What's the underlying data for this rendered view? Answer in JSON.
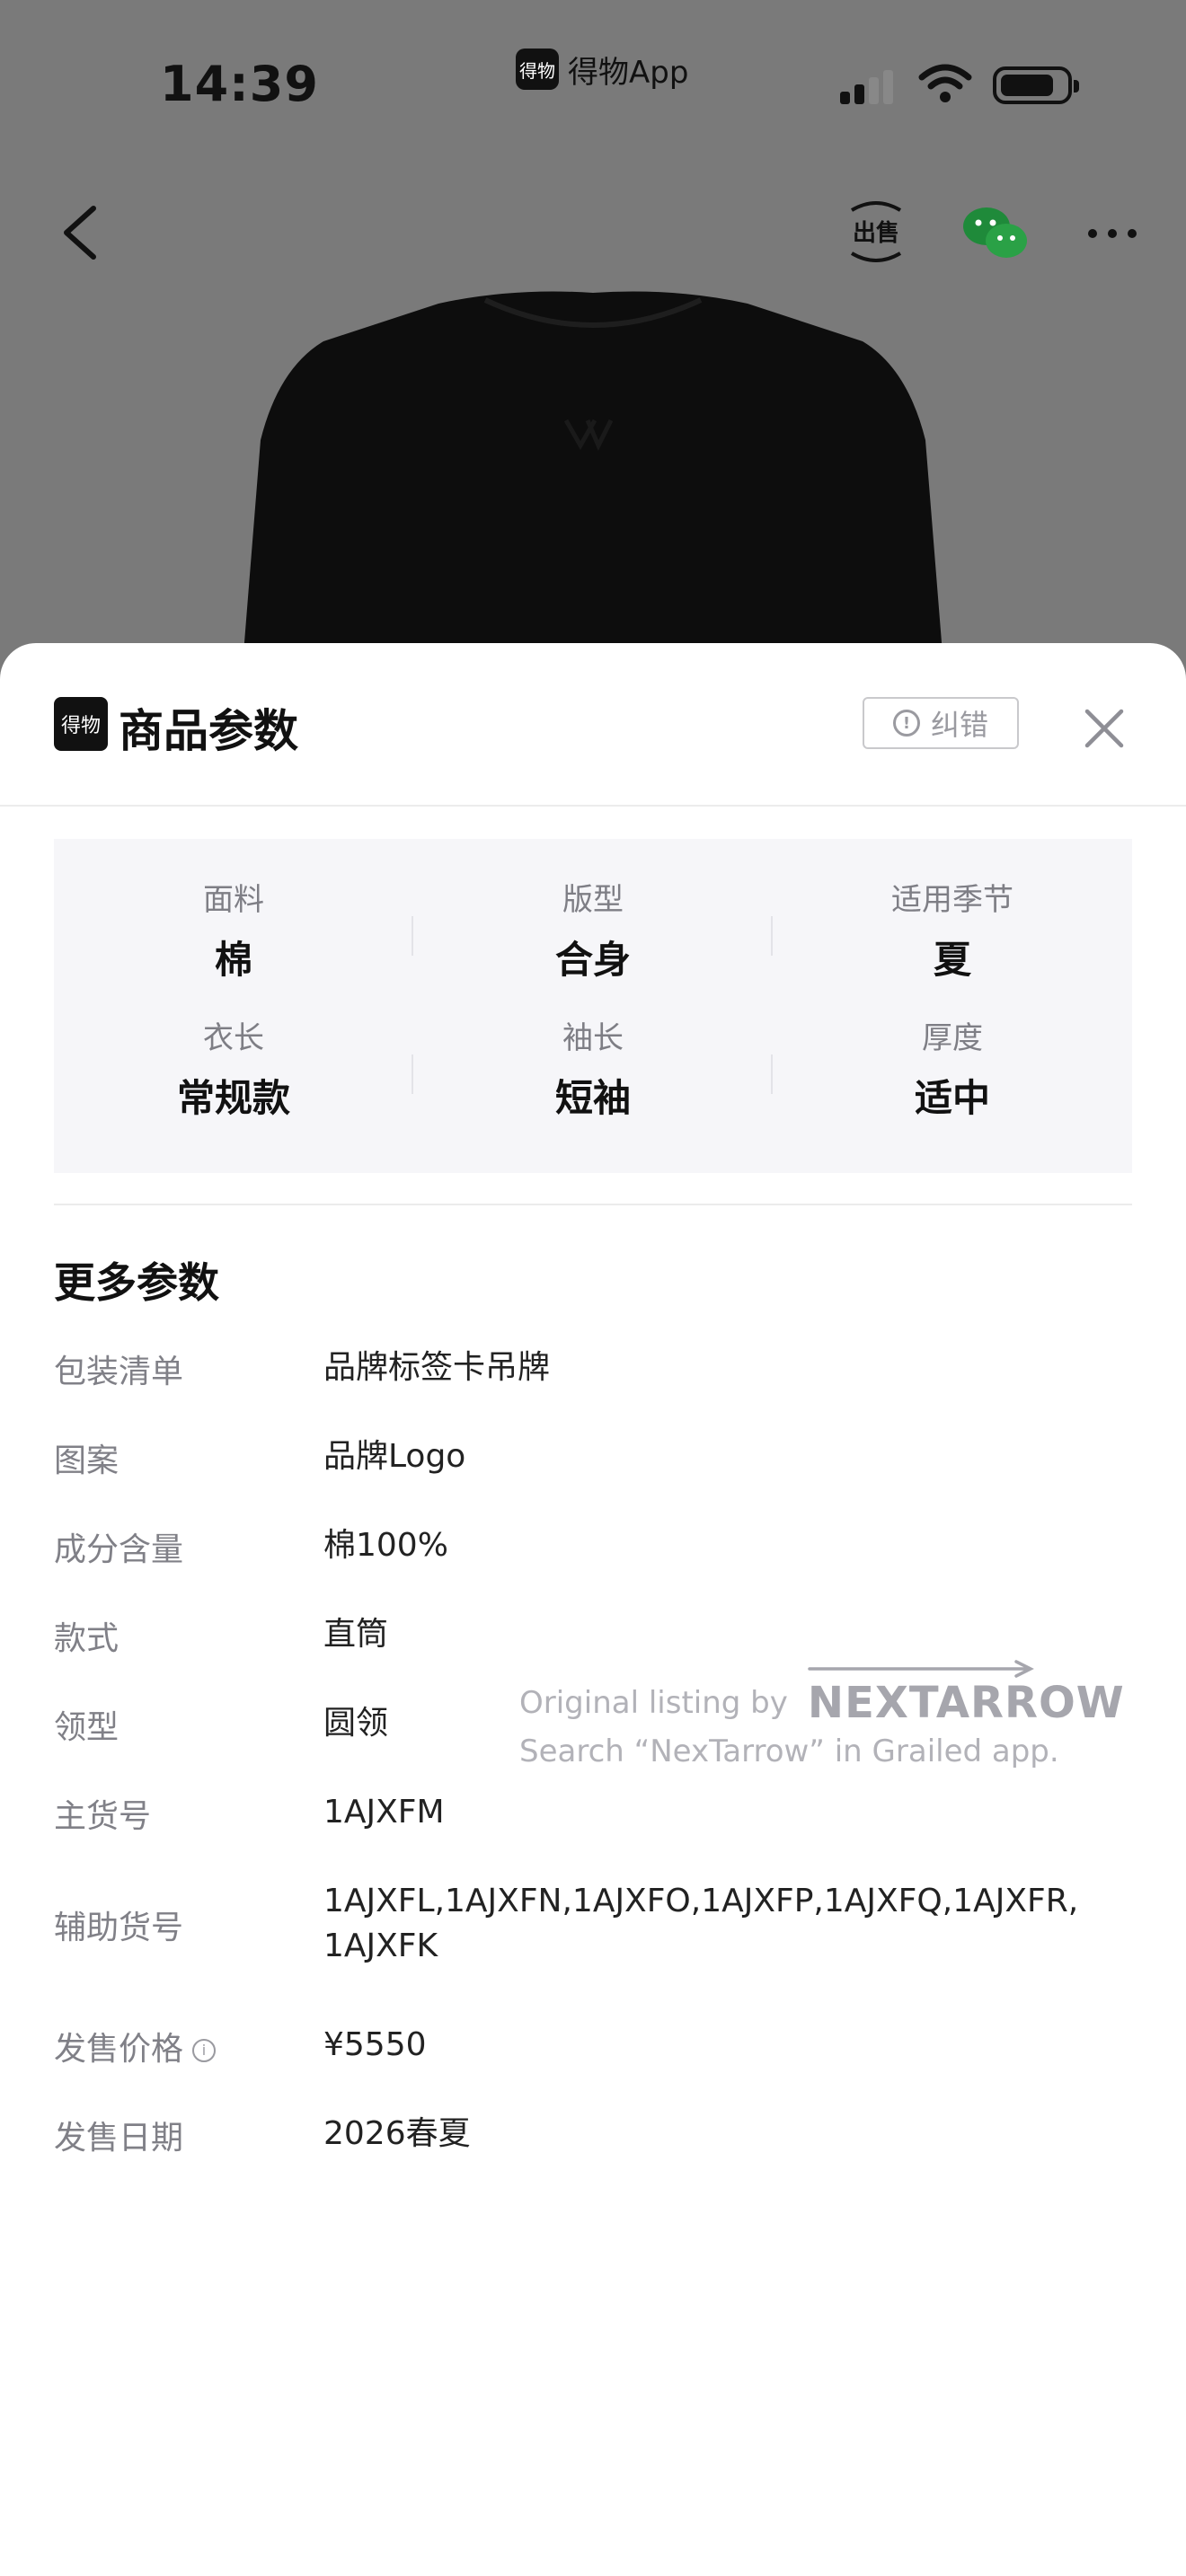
{
  "status_bar": {
    "time": "14:39",
    "app_logo_text": "得物",
    "app_name": "得物App"
  },
  "nav": {
    "sell_label": "出售"
  },
  "sheet": {
    "logo_text": "得物",
    "title": "商品参数",
    "report_label": "纠错"
  },
  "key_params": [
    {
      "label": "面料",
      "value": "棉"
    },
    {
      "label": "版型",
      "value": "合身"
    },
    {
      "label": "适用季节",
      "value": "夏"
    },
    {
      "label": "衣长",
      "value": "常规款"
    },
    {
      "label": "袖长",
      "value": "短袖"
    },
    {
      "label": "厚度",
      "value": "适中"
    }
  ],
  "more_params": {
    "title": "更多参数",
    "rows": [
      {
        "label": "包装清单",
        "value": "品牌标签卡吊牌"
      },
      {
        "label": "图案",
        "value": "品牌Logo"
      },
      {
        "label": "成分含量",
        "value": "棉100%"
      },
      {
        "label": "款式",
        "value": "直筒"
      },
      {
        "label": "领型",
        "value": "圆领"
      },
      {
        "label": "主货号",
        "value": "1AJXFM"
      },
      {
        "label": "辅助货号",
        "value": "1AJXFL,1AJXFN,1AJXFO,1AJXFP,1AJXFQ,1AJXFR,\n1AJXFK"
      },
      {
        "label": "发售价格",
        "value": "¥5550"
      },
      {
        "label": "发售日期",
        "value": "2026春夏"
      }
    ]
  },
  "watermark": {
    "prefix": "Original listing by",
    "brand": "NEXTARROW",
    "line2": "Search “NexTarrow” in Grailed app."
  }
}
